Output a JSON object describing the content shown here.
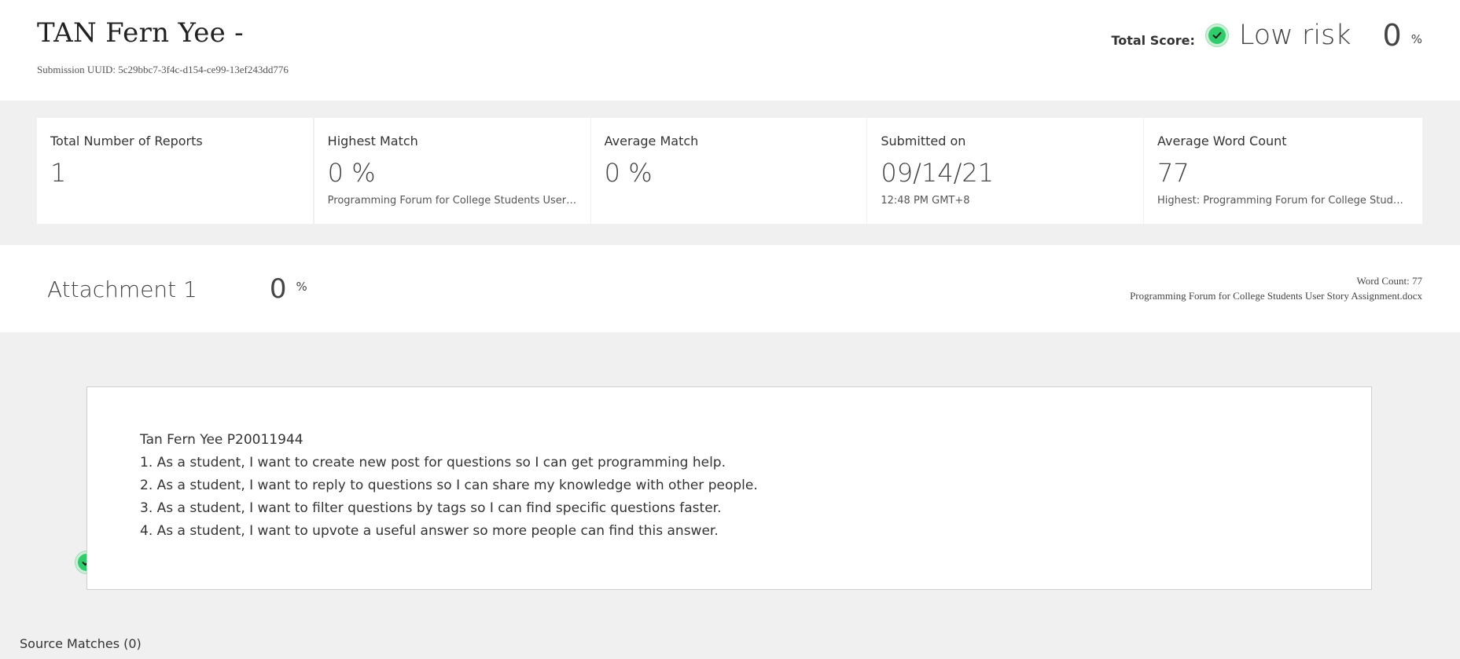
{
  "header": {
    "title": "TAN Fern Yee -",
    "uuid_label": "Submission UUID: 5c29bbc7-3f4c-d154-ce99-13ef243dd776",
    "total_score_label": "Total Score:",
    "risk_label": "Low risk",
    "score_value": "0",
    "score_unit": "%",
    "status_icon": "check-circle-icon",
    "status_color": "#2ecc6a"
  },
  "stats": [
    {
      "label": "Total Number of Reports",
      "value": "1",
      "sub": ""
    },
    {
      "label": "Highest Match",
      "value": "0 %",
      "sub": "Programming Forum for College Students User S..."
    },
    {
      "label": "Average Match",
      "value": "0 %",
      "sub": ""
    },
    {
      "label": "Submitted on",
      "value": "09/14/21",
      "sub": "12:48 PM GMT+8"
    },
    {
      "label": "Average Word Count",
      "value": "77",
      "sub": "Highest: Programming Forum for College Studen..."
    }
  ],
  "attachment": {
    "name": "Attachment 1",
    "score": "0",
    "unit": "%",
    "word_count": "Word Count: 77",
    "filename": "Programming Forum for College Students User Story Assignment.docx"
  },
  "document": {
    "lines": [
      "Tan Fern Yee P20011944",
      "1. As a student, I want to create new post for questions so I can get programming help.",
      "2. As a student, I want to reply to questions so I can share my knowledge with other people.",
      "3. As a student, I want to filter questions by tags so I can find specific questions faster.",
      "4. As a student, I want to upvote a useful answer so more people can find this answer."
    ]
  },
  "source_matches": "Source Matches (0)"
}
